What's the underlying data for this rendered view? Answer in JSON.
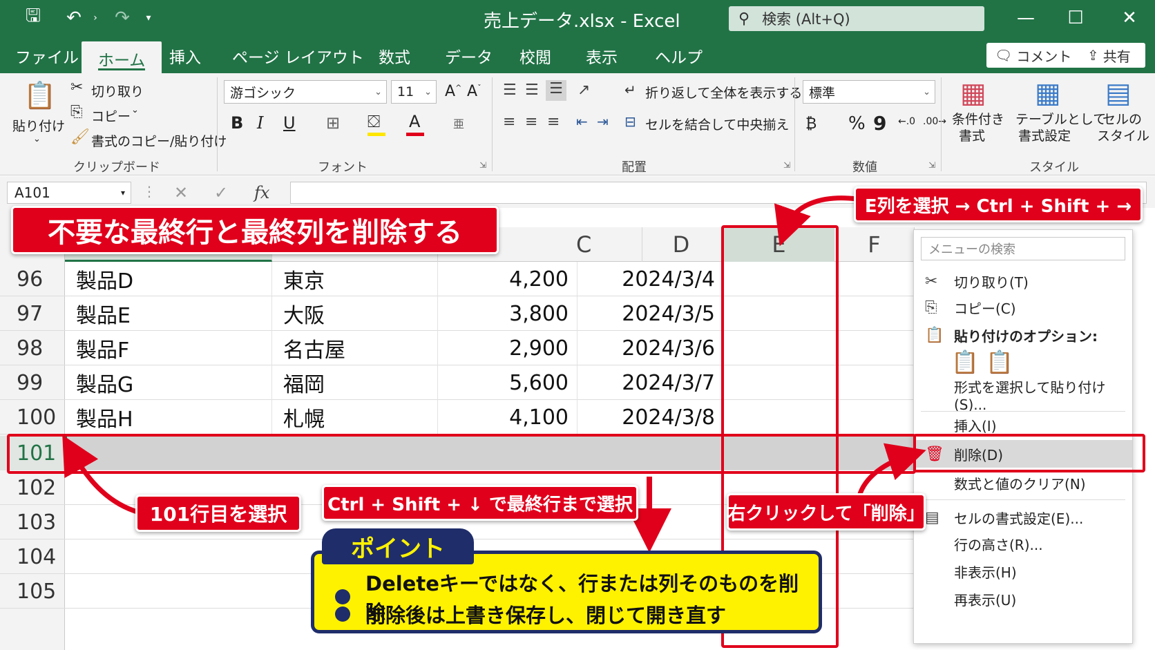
{
  "window": {
    "title": "売上データ.xlsx  -  Excel",
    "search_placeholder": "検索 (Alt+Q)",
    "controls": [
      "minimize-icon",
      "maximize-icon",
      "close-icon"
    ]
  },
  "tabs": [
    "ファイル",
    "ホーム",
    "挿入",
    "ページ レイアウト",
    "数式",
    "データ",
    "校閲",
    "表示",
    "ヘルプ"
  ],
  "active_tab": "ホーム",
  "top_buttons": {
    "comment": "コメント",
    "share": "共有"
  },
  "ribbon": {
    "clipboard": {
      "paste": "貼り付け",
      "cut": "切り取り",
      "copy": "コピー",
      "format_painter": "書式のコピー/貼り付け",
      "label": "クリップボード"
    },
    "font": {
      "name": "游ゴシック",
      "size": "11",
      "bold": "B",
      "italic": "I",
      "underline": "U",
      "label": "フォント"
    },
    "alignment": {
      "wrap": "折り返して全体を表示する",
      "merge": "セルを結合して中央揃え",
      "label": "配置"
    },
    "number": {
      "format": "標準",
      "percent": "%",
      "comma": "9",
      "label": "数値"
    },
    "styles": {
      "conditional": "条件付き",
      "conditional2": "書式",
      "table": "テーブルとして",
      "table2": "書式設定",
      "cell": "セルの",
      "cell2": "スタイル",
      "label": "スタイル"
    }
  },
  "formula_bar": {
    "name_box": "A101",
    "fx": "fx"
  },
  "sheet": {
    "columns": [
      "C",
      "D",
      "E",
      "F"
    ],
    "rows": [
      {
        "num": "96",
        "product": "製品D",
        "city": "東京",
        "amount": "4,200",
        "date": "2024/3/4"
      },
      {
        "num": "97",
        "product": "製品E",
        "city": "大阪",
        "amount": "3,800",
        "date": "2024/3/5"
      },
      {
        "num": "98",
        "product": "製品F",
        "city": "名古屋",
        "amount": "2,900",
        "date": "2024/3/6"
      },
      {
        "num": "99",
        "product": "製品G",
        "city": "福岡",
        "amount": "5,600",
        "date": "2024/3/7"
      },
      {
        "num": "100",
        "product": "製品H",
        "city": "札幌",
        "amount": "4,100",
        "date": "2024/3/8"
      }
    ],
    "selected_row": "101",
    "empty_rows": [
      "102",
      "103",
      "104",
      "105"
    ]
  },
  "context_menu": {
    "search": "メニューの検索",
    "items": {
      "cut": "切り取り(T)",
      "copy": "コピー(C)",
      "paste_options": "貼り付けのオプション:",
      "paste_special": "形式を選択して貼り付け(S)...",
      "insert": "挿入(I)",
      "delete": "削除(D)",
      "clear": "数式と値のクリア(N)",
      "format_cells": "セルの書式設定(E)...",
      "row_height": "行の高さ(R)...",
      "hide": "非表示(H)",
      "unhide": "再表示(U)"
    }
  },
  "annotations": {
    "headline": "不要な最終行と最終列を削除する",
    "select_e": "E列を選択 → Ctrl + Shift + →",
    "select_101": "101行目を選択",
    "select_last": "Ctrl + Shift + ↓ で最終行まで選択",
    "right_click": "右クリックして「削除」",
    "point_title": "ポイント",
    "point_1": "Deleteキーではなく、行または列そのものを削除",
    "point_2": "削除後は上書き保存し、閉じて開き直す"
  },
  "colors": {
    "excel_green": "#217346",
    "annotation_red": "#e0001b",
    "point_yellow": "#fff200",
    "point_navy": "#1f2d6b"
  }
}
